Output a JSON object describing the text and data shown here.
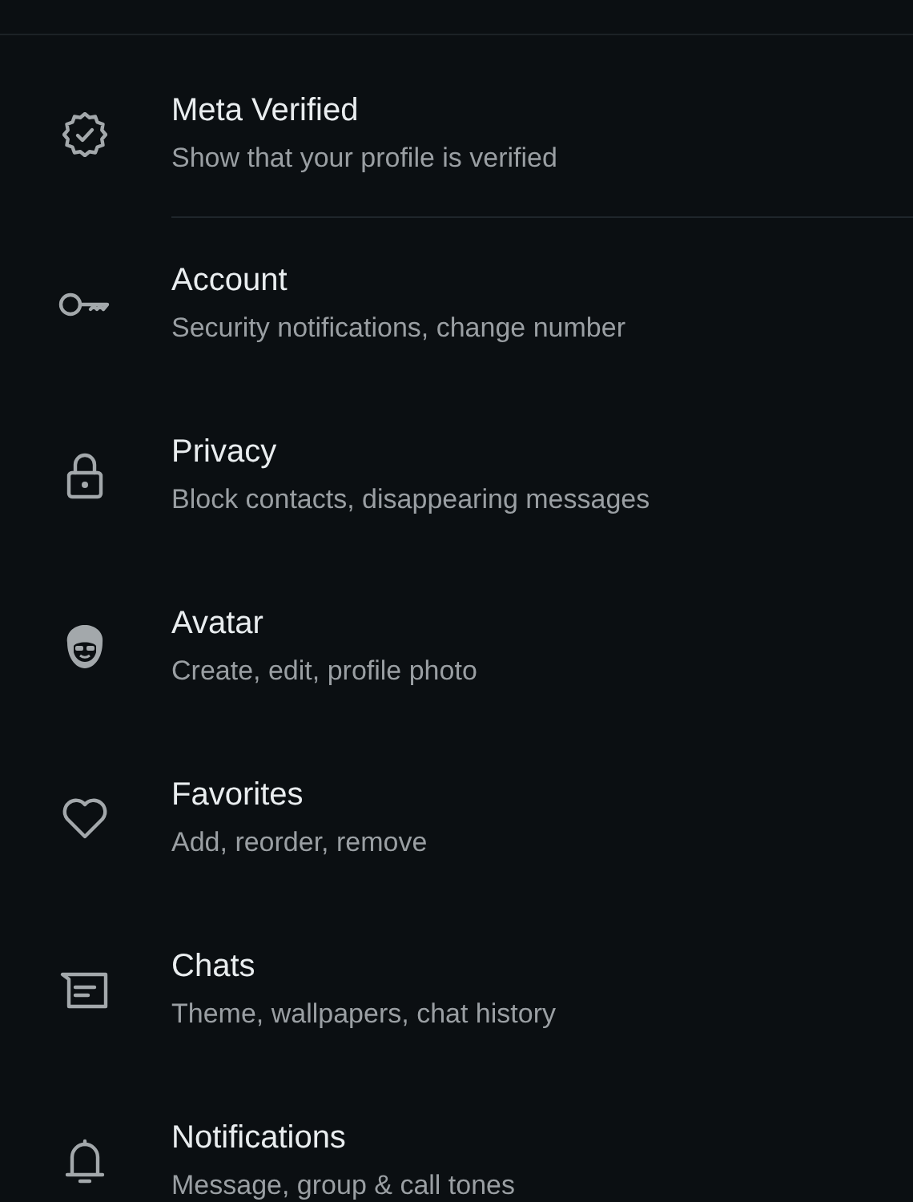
{
  "sections": [
    {
      "items": [
        {
          "title": "Meta Verified",
          "subtitle": "Show that your profile is verified"
        }
      ]
    },
    {
      "items": [
        {
          "title": "Account",
          "subtitle": "Security notifications, change number"
        },
        {
          "title": "Privacy",
          "subtitle": "Block contacts, disappearing messages"
        },
        {
          "title": "Avatar",
          "subtitle": "Create, edit, profile photo"
        },
        {
          "title": "Favorites",
          "subtitle": "Add, reorder, remove"
        },
        {
          "title": "Chats",
          "subtitle": "Theme, wallpapers, chat history"
        },
        {
          "title": "Notifications",
          "subtitle": "Message, group & call tones"
        }
      ]
    }
  ]
}
